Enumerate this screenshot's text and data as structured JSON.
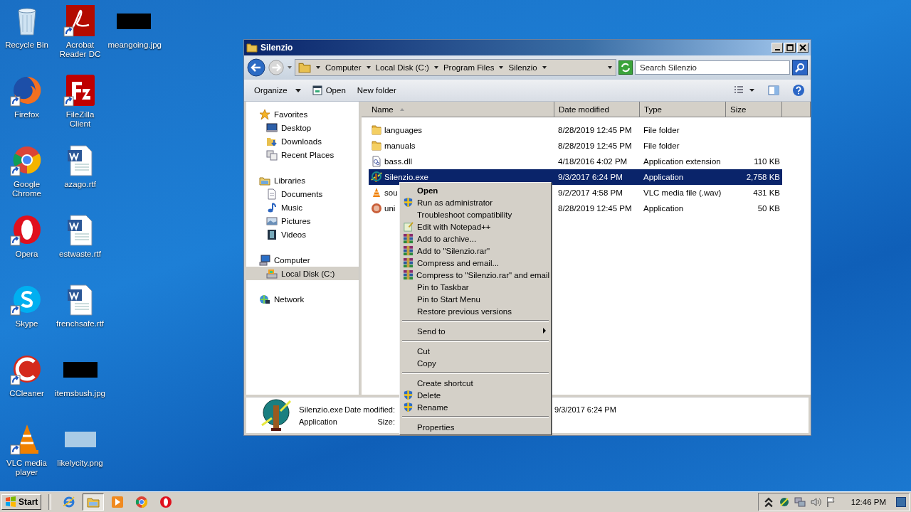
{
  "desktop_icons": [
    {
      "label": "Recycle Bin",
      "kind": "recycle",
      "shortcut": false
    },
    {
      "label": "Firefox",
      "kind": "firefox",
      "shortcut": true
    },
    {
      "label": "Google Chrome",
      "kind": "chrome",
      "shortcut": true
    },
    {
      "label": "Opera",
      "kind": "opera",
      "shortcut": true
    },
    {
      "label": "Skype",
      "kind": "skype",
      "shortcut": true
    },
    {
      "label": "CCleaner",
      "kind": "ccleaner",
      "shortcut": true
    },
    {
      "label": "VLC media player",
      "kind": "vlc",
      "shortcut": true
    },
    {
      "label": "Acrobat Reader DC",
      "kind": "pdf",
      "shortcut": true
    },
    {
      "label": "FileZilla Client",
      "kind": "filezilla",
      "shortcut": true
    },
    {
      "label": "azago.rtf",
      "kind": "doc",
      "shortcut": false
    },
    {
      "label": "estwaste.rtf",
      "kind": "doc",
      "shortcut": false
    },
    {
      "label": "frenchsafe.rtf",
      "kind": "doc",
      "shortcut": false
    },
    {
      "label": "itemsbush.jpg",
      "kind": "dark",
      "shortcut": false
    },
    {
      "label": "likelycity.png",
      "kind": "light",
      "shortcut": false
    },
    {
      "label": "meangoing.jpg",
      "kind": "dark",
      "shortcut": false
    }
  ],
  "window": {
    "title": "Silenzio",
    "breadcrumb": [
      "Computer",
      "Local Disk (C:)",
      "Program Files",
      "Silenzio"
    ],
    "search": {
      "placeholder": "Search Silenzio"
    },
    "toolbar": [
      {
        "label": "Organize",
        "kind": "menu"
      },
      {
        "label": "Open",
        "kind": "icon"
      },
      {
        "label": "New folder",
        "kind": "plain"
      }
    ],
    "nav_pane": [
      {
        "label": "Favorites",
        "kind": "star",
        "selected": false,
        "children": [
          {
            "label": "Desktop",
            "kind": "desktop",
            "selected": false
          },
          {
            "label": "Downloads",
            "kind": "downloads",
            "selected": false
          },
          {
            "label": "Recent Places",
            "kind": "recent",
            "selected": false
          }
        ]
      },
      {
        "label": "Libraries",
        "kind": "library",
        "selected": false,
        "children": [
          {
            "label": "Documents",
            "kind": "documents",
            "selected": false
          },
          {
            "label": "Music",
            "kind": "music",
            "selected": false
          },
          {
            "label": "Pictures",
            "kind": "pictures",
            "selected": false
          },
          {
            "label": "Videos",
            "kind": "videos",
            "selected": false
          }
        ]
      },
      {
        "label": "Computer",
        "kind": "computer",
        "selected": false,
        "children": [
          {
            "label": "Local Disk (C:)",
            "kind": "disk",
            "selected": true
          }
        ]
      },
      {
        "label": "Network",
        "kind": "network",
        "selected": false
      }
    ],
    "columns": [
      "Name",
      "Date modified",
      "Type",
      "Size"
    ],
    "files": [
      {
        "name": "languages",
        "date": "8/28/2019 12:45 PM",
        "type": "File folder",
        "kind": "folder",
        "selected": false
      },
      {
        "name": "manuals",
        "date": "8/28/2019 12:45 PM",
        "type": "File folder",
        "kind": "folder",
        "selected": false
      },
      {
        "name": "bass.dll",
        "date": "4/18/2016 4:02 PM",
        "type": "Application extension",
        "size": "110 KB",
        "kind": "dll",
        "selected": false
      },
      {
        "name": "Silenzio.exe",
        "date": "9/3/2017 6:24 PM",
        "type": "Application",
        "size": "2,758 KB",
        "kind": "app",
        "selected": true
      },
      {
        "name": "sou",
        "date": "9/2/2017 4:58 PM",
        "type": "VLC media file (.wav)",
        "size": "431 KB",
        "kind": "vlc",
        "selected": false
      },
      {
        "name": "uni",
        "date": "8/28/2019 12:45 PM",
        "type": "Application",
        "size": "50 KB",
        "kind": "uninstall",
        "selected": false
      }
    ],
    "details": {
      "name": "Silenzio.exe",
      "type": "Application",
      "date_label": "Date modified:",
      "size_label": "Size:",
      "date_value": "9/3/2017 6:24 PM"
    }
  },
  "context_menu": [
    {
      "kind": "plain",
      "label": "Open",
      "default": true,
      "submenu": false
    },
    {
      "kind": "shield",
      "label": "Run as administrator",
      "default": false,
      "submenu": false
    },
    {
      "kind": "plain",
      "label": "Troubleshoot compatibility",
      "default": false,
      "submenu": false
    },
    {
      "kind": "notepad",
      "label": "Edit with Notepad++",
      "default": false,
      "submenu": false
    },
    {
      "kind": "rar",
      "label": "Add to archive...",
      "default": false,
      "submenu": false
    },
    {
      "kind": "rar",
      "label": "Add to \"Silenzio.rar\"",
      "default": false,
      "submenu": false
    },
    {
      "kind": "rar",
      "label": "Compress and email...",
      "default": false,
      "submenu": false
    },
    {
      "kind": "rar",
      "label": "Compress to \"Silenzio.rar\" and email",
      "default": false,
      "submenu": false
    },
    {
      "kind": "plain",
      "label": "Pin to Taskbar",
      "default": false,
      "submenu": false
    },
    {
      "kind": "plain",
      "label": "Pin to Start Menu",
      "default": false,
      "submenu": false
    },
    {
      "kind": "plain",
      "label": "Restore previous versions",
      "default": false,
      "submenu": false
    },
    {
      "kind": "separator"
    },
    {
      "kind": "plain",
      "label": "Send to",
      "default": false,
      "submenu": true
    },
    {
      "kind": "separator"
    },
    {
      "kind": "plain",
      "label": "Cut",
      "default": false,
      "submenu": false
    },
    {
      "kind": "plain",
      "label": "Copy",
      "default": false,
      "submenu": false
    },
    {
      "kind": "separator"
    },
    {
      "kind": "plain",
      "label": "Create shortcut",
      "default": false,
      "submenu": false
    },
    {
      "kind": "shield",
      "label": "Delete",
      "default": false,
      "submenu": false
    },
    {
      "kind": "shield",
      "label": "Rename",
      "default": false,
      "submenu": false
    },
    {
      "kind": "separator"
    },
    {
      "kind": "plain",
      "label": "Properties",
      "default": false,
      "submenu": false
    }
  ],
  "taskbar": {
    "start": "Start",
    "apps": [
      {
        "kind": "ie",
        "selected": false
      },
      {
        "kind": "explorer",
        "selected": true
      },
      {
        "kind": "media",
        "selected": false
      },
      {
        "kind": "chrome",
        "selected": false
      },
      {
        "kind": "opera",
        "selected": false
      }
    ],
    "clock": "12:46 PM"
  }
}
